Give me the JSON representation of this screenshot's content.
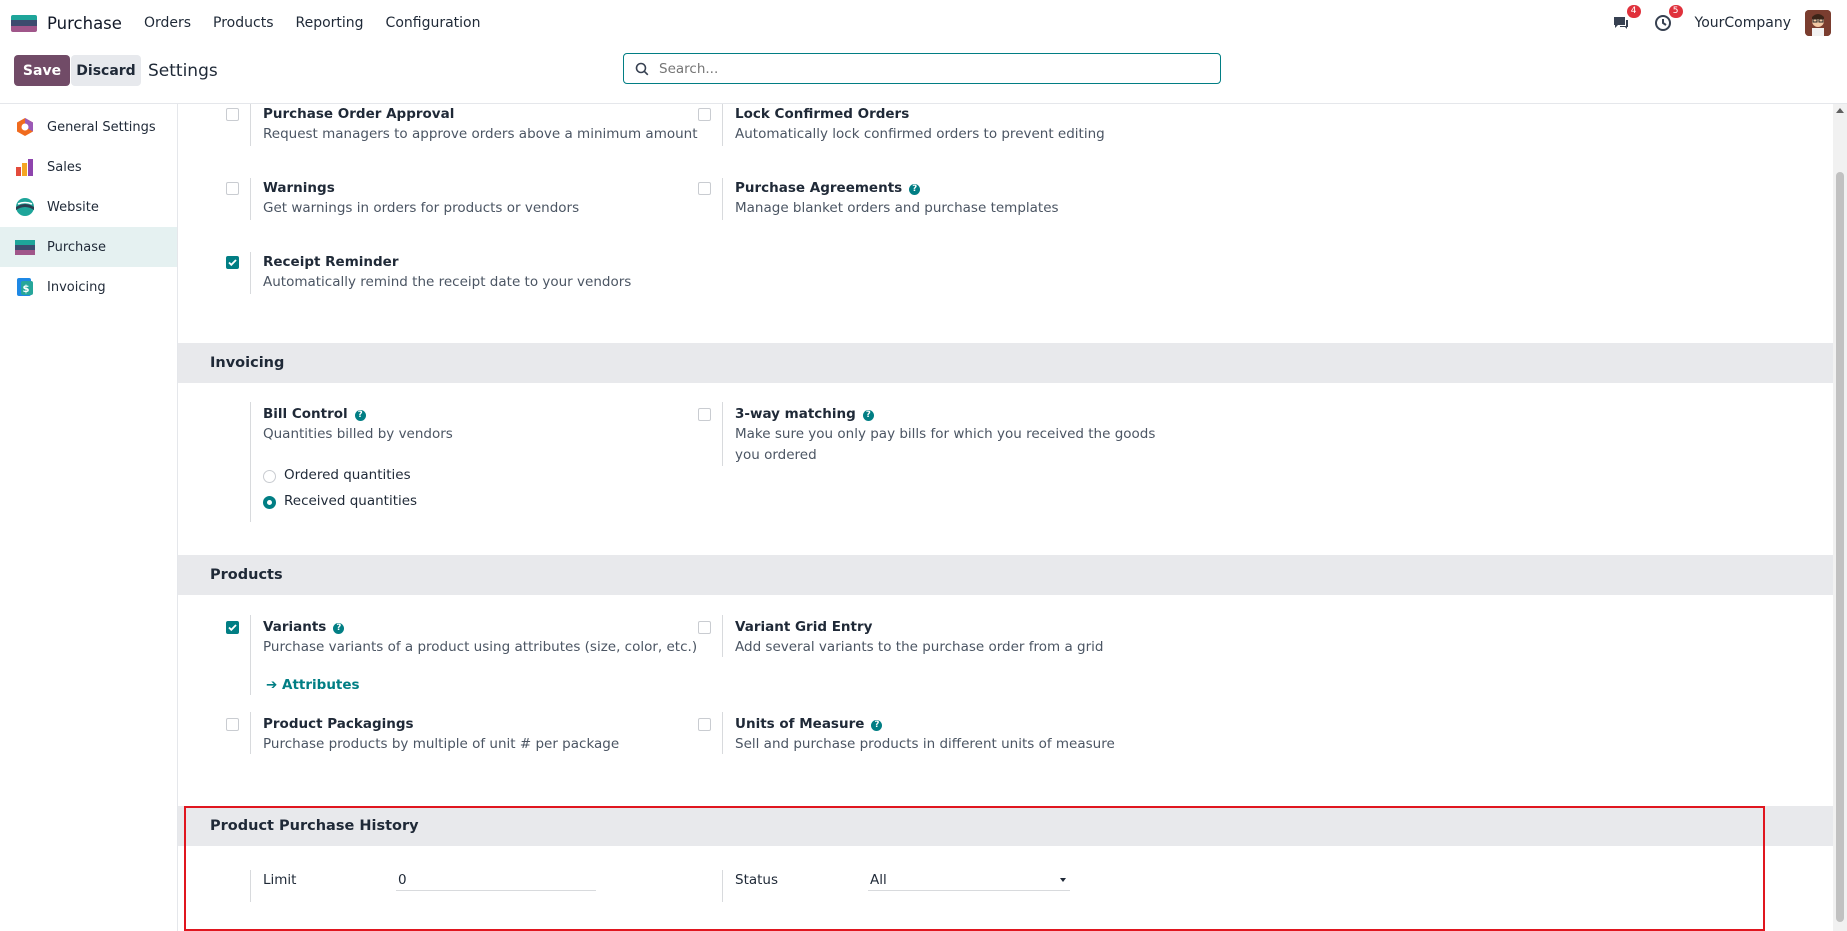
{
  "topbar": {
    "app_name": "Purchase",
    "menu": [
      "Orders",
      "Products",
      "Reporting",
      "Configuration"
    ],
    "messages_count": "4",
    "activities_count": "5",
    "company": "YourCompany"
  },
  "control": {
    "save_label": "Save",
    "discard_label": "Discard",
    "title": "Settings",
    "search_placeholder": "Search..."
  },
  "sidebar": {
    "items": [
      {
        "label": "General Settings",
        "icon": "settings-app-icon"
      },
      {
        "label": "Sales",
        "icon": "sales-app-icon"
      },
      {
        "label": "Website",
        "icon": "website-app-icon"
      },
      {
        "label": "Purchase",
        "icon": "purchase-app-icon",
        "active": true
      },
      {
        "label": "Invoicing",
        "icon": "invoicing-app-icon"
      }
    ]
  },
  "orders": {
    "po_approval": {
      "title": "Purchase Order Approval",
      "desc": "Request managers to approve orders above a minimum amount",
      "checked": false
    },
    "lock_confirmed": {
      "title": "Lock Confirmed Orders",
      "desc": "Automatically lock confirmed orders to prevent editing",
      "checked": false
    },
    "warnings": {
      "title": "Warnings",
      "desc": "Get warnings in orders for products or vendors",
      "checked": false
    },
    "agreements": {
      "title": "Purchase Agreements",
      "desc": "Manage blanket orders and purchase templates",
      "checked": false
    },
    "receipt_reminder": {
      "title": "Receipt Reminder",
      "desc": "Automatically remind the receipt date to your vendors",
      "checked": true
    }
  },
  "invoicing": {
    "section_title": "Invoicing",
    "bill_control": {
      "title": "Bill Control",
      "desc": "Quantities billed by vendors"
    },
    "options": [
      "Ordered quantities",
      "Received quantities"
    ],
    "selected_option": "Received quantities",
    "three_way": {
      "title": "3-way matching",
      "desc_line1": "Make sure you only pay bills for which you received the goods",
      "desc_line2": "you ordered",
      "checked": false
    }
  },
  "products": {
    "section_title": "Products",
    "variants": {
      "title": "Variants",
      "desc": "Purchase variants of a product using attributes (size, color, etc.)",
      "checked": true,
      "link": "Attributes"
    },
    "variant_grid": {
      "title": "Variant Grid Entry",
      "desc": "Add several variants to the purchase order from a grid",
      "checked": false
    },
    "packagings": {
      "title": "Product Packagings",
      "desc": "Purchase products by multiple of unit # per package",
      "checked": false
    },
    "uom": {
      "title": "Units of Measure",
      "desc": "Sell and purchase products in different units of measure",
      "checked": false
    }
  },
  "history": {
    "section_title": "Product Purchase History",
    "limit_label": "Limit",
    "limit_value": "0",
    "status_label": "Status",
    "status_value": "All"
  },
  "colors": {
    "brand": "#714b67",
    "accent": "#017e84",
    "highlight": "#e0161f"
  }
}
